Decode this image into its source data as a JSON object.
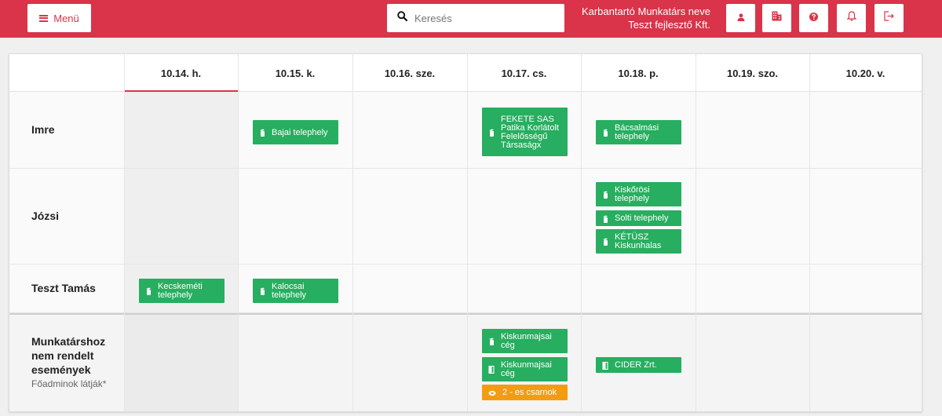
{
  "header": {
    "menu_label": "Menü",
    "search_placeholder": "Keresés",
    "user_name": "Karbantartó Munkatárs neve",
    "company": "Teszt fejlesztő Kft.",
    "icons": [
      "user-icon",
      "building-icon",
      "help-icon",
      "bell-icon",
      "logout-icon"
    ],
    "accent": "#d9344a"
  },
  "days": [
    "10.14. h.",
    "10.15. k.",
    "10.16. sze.",
    "10.17. cs.",
    "10.18. p.",
    "10.19. szo.",
    "10.20. v."
  ],
  "rows": [
    {
      "name": "Imre"
    },
    {
      "name": "Józsi"
    },
    {
      "name": "Teszt Tamás"
    },
    {
      "name": "Munkatárshoz nem rendelt események",
      "sub": "Főadminok látják*"
    }
  ],
  "events": [
    {
      "label": "Bajai telephely",
      "icon": "fire-extinguisher-icon",
      "color": "#27ae60"
    },
    {
      "label": "FEKETE SAS Patika Korlátolt Felelősségű Társaságx",
      "icon": "fire-extinguisher-icon",
      "color": "#27ae60"
    },
    {
      "label": "Bácsalmási telephely",
      "icon": "fire-extinguisher-icon",
      "color": "#27ae60"
    },
    {
      "label": "Kiskőrösi telephely",
      "icon": "fire-extinguisher-icon",
      "color": "#27ae60"
    },
    {
      "label": "Solti telephely",
      "icon": "fire-extinguisher-icon",
      "color": "#27ae60"
    },
    {
      "label": "KÉTÜSZ Kiskunhalas",
      "icon": "fire-extinguisher-icon",
      "color": "#27ae60"
    },
    {
      "label": "Kecskeméti telephely",
      "icon": "fire-extinguisher-icon",
      "color": "#27ae60"
    },
    {
      "label": "Kalocsai telephely",
      "icon": "fire-extinguisher-icon",
      "color": "#27ae60"
    },
    {
      "label": "Kiskunmajsai cég",
      "icon": "fire-extinguisher-icon",
      "color": "#27ae60"
    },
    {
      "label": "Kiskunmajsai cég",
      "icon": "door-icon",
      "color": "#27ae60"
    },
    {
      "label": "2 - es csarnok",
      "icon": "hose-icon",
      "color": "#f39c12"
    },
    {
      "label": "CIDER Zrt.",
      "icon": "door-icon",
      "color": "#27ae60"
    }
  ]
}
